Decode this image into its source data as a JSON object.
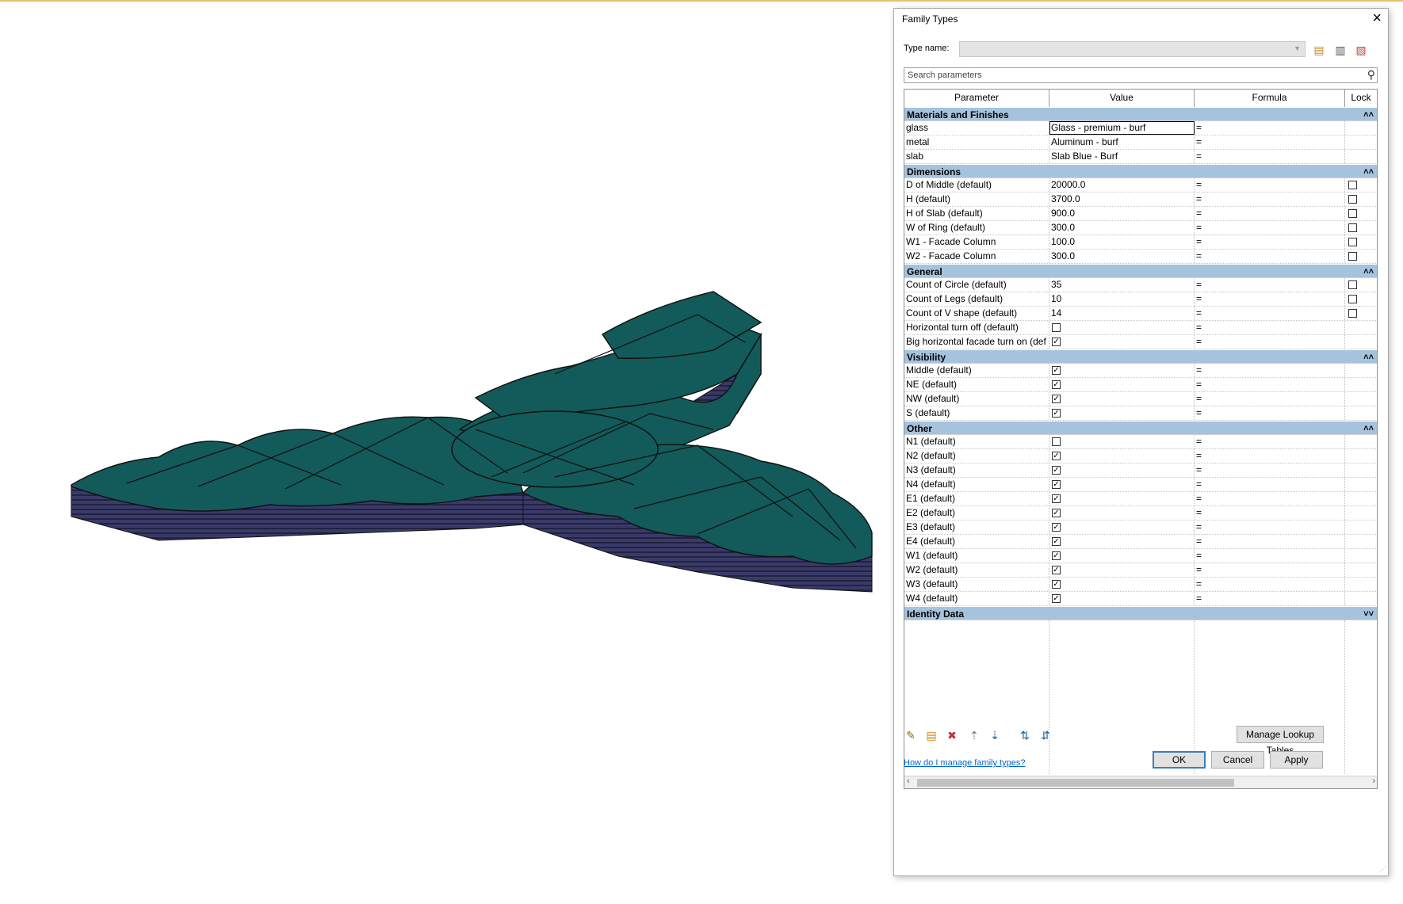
{
  "dialog": {
    "title": "Family Types",
    "type_name_label": "Type name:",
    "search_placeholder": "Search parameters",
    "columns": [
      "Parameter",
      "Value",
      "Formula",
      "Lock"
    ],
    "groups": [
      {
        "name": "Materials and Finishes",
        "collapse_glyph": "˄˄",
        "rows": [
          {
            "param": "glass",
            "kind": "text",
            "value": "Glass - premium - burf",
            "formula": "=",
            "lock": null,
            "editing": true
          },
          {
            "param": "metal",
            "kind": "text",
            "value": "Aluminum - burf",
            "formula": "=",
            "lock": null
          },
          {
            "param": "slab",
            "kind": "text",
            "value": "Slab Blue - Burf",
            "formula": "=",
            "lock": null
          }
        ]
      },
      {
        "name": "Dimensions",
        "collapse_glyph": "˄˄",
        "rows": [
          {
            "param": "D of Middle (default)",
            "kind": "text",
            "value": "20000.0",
            "formula": "=",
            "lock": false
          },
          {
            "param": "H (default)",
            "kind": "text",
            "value": "3700.0",
            "formula": "=",
            "lock": false
          },
          {
            "param": "H of Slab (default)",
            "kind": "text",
            "value": "900.0",
            "formula": "=",
            "lock": false
          },
          {
            "param": "W of Ring (default)",
            "kind": "text",
            "value": "300.0",
            "formula": "=",
            "lock": false
          },
          {
            "param": "W1 - Facade Column",
            "kind": "text",
            "value": "100.0",
            "formula": "=",
            "lock": false
          },
          {
            "param": "W2 - Facade Column",
            "kind": "text",
            "value": "300.0",
            "formula": "=",
            "lock": false
          }
        ]
      },
      {
        "name": "General",
        "collapse_glyph": "˄˄",
        "rows": [
          {
            "param": "Count of Circle (default)",
            "kind": "text",
            "value": "35",
            "formula": "=",
            "lock": false
          },
          {
            "param": "Count of Legs (default)",
            "kind": "text",
            "value": "10",
            "formula": "=",
            "lock": false
          },
          {
            "param": "Count of V shape (default)",
            "kind": "text",
            "value": "14",
            "formula": "=",
            "lock": false
          },
          {
            "param": "Horizontal turn off (default)",
            "kind": "check",
            "checked": false,
            "formula": "=",
            "lock": null
          },
          {
            "param": "Big horizontal facade turn on (def",
            "kind": "check",
            "checked": true,
            "formula": "=",
            "lock": null
          }
        ]
      },
      {
        "name": "Visibility",
        "collapse_glyph": "˄˄",
        "rows": [
          {
            "param": "Middle (default)",
            "kind": "check",
            "checked": true,
            "formula": "=",
            "lock": null
          },
          {
            "param": "NE (default)",
            "kind": "check",
            "checked": true,
            "formula": "=",
            "lock": null
          },
          {
            "param": "NW (default)",
            "kind": "check",
            "checked": true,
            "formula": "=",
            "lock": null
          },
          {
            "param": "S (default)",
            "kind": "check",
            "checked": true,
            "formula": "=",
            "lock": null
          }
        ]
      },
      {
        "name": "Other",
        "collapse_glyph": "˄˄",
        "rows": [
          {
            "param": "N1 (default)",
            "kind": "check",
            "checked": false,
            "formula": "=",
            "lock": null
          },
          {
            "param": "N2 (default)",
            "kind": "check",
            "checked": true,
            "formula": "=",
            "lock": null
          },
          {
            "param": "N3 (default)",
            "kind": "check",
            "checked": true,
            "formula": "=",
            "lock": null
          },
          {
            "param": "N4 (default)",
            "kind": "check",
            "checked": true,
            "formula": "=",
            "lock": null
          },
          {
            "param": "E1 (default)",
            "kind": "check",
            "checked": true,
            "formula": "=",
            "lock": null
          },
          {
            "param": "E2 (default)",
            "kind": "check",
            "checked": true,
            "formula": "=",
            "lock": null
          },
          {
            "param": "E3 (default)",
            "kind": "check",
            "checked": true,
            "formula": "=",
            "lock": null
          },
          {
            "param": "E4 (default)",
            "kind": "check",
            "checked": true,
            "formula": "=",
            "lock": null
          },
          {
            "param": "W1 (default)",
            "kind": "check",
            "checked": true,
            "formula": "=",
            "lock": null
          },
          {
            "param": "W2 (default)",
            "kind": "check",
            "checked": true,
            "formula": "=",
            "lock": null
          },
          {
            "param": "W3 (default)",
            "kind": "check",
            "checked": true,
            "formula": "=",
            "lock": null
          },
          {
            "param": "W4 (default)",
            "kind": "check",
            "checked": true,
            "formula": "=",
            "lock": null
          }
        ]
      },
      {
        "name": "Identity Data",
        "collapse_glyph": "˅˅",
        "rows": []
      }
    ],
    "toolbar_icons": [
      "edit-pencil-icon",
      "new-parameter-icon",
      "delete-parameter-icon",
      "move-up-icon",
      "move-down-icon",
      "sort-ascending-icon",
      "sort-descending-icon"
    ],
    "manage_lookup_label": "Manage Lookup Tables",
    "help_link": "How do I manage family types?",
    "ok_label": "OK",
    "cancel_label": "Cancel",
    "apply_label": "Apply"
  },
  "colors": {
    "model_top": "#135a5a",
    "model_side": "#3a3a6a",
    "group_header": "#a6c3de"
  }
}
